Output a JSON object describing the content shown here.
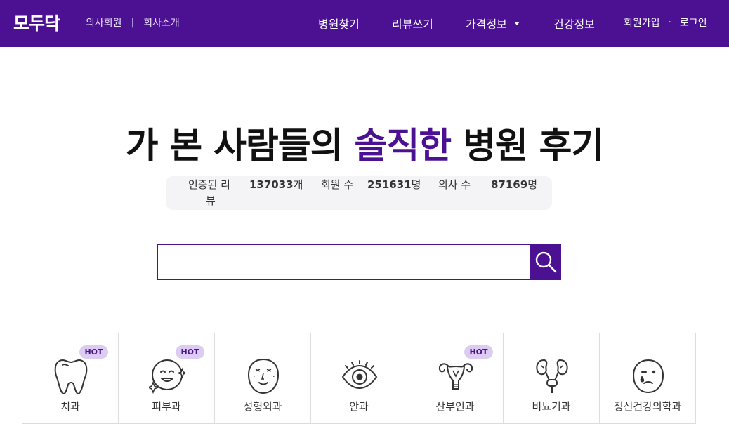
{
  "header": {
    "logo": "모두닥",
    "doctor_member": "의사회원",
    "divider": "|",
    "company_intro": "회사소개",
    "nav": {
      "find_hospital": "병원찾기",
      "write_review": "리뷰쓰기",
      "price_info": "가격정보",
      "health_info": "건강정보"
    },
    "signup": "회원가입",
    "dot": "·",
    "login": "로그인"
  },
  "hero": {
    "title_before": "가 본 사람들의",
    "title_accent": "솔직한",
    "title_after": "병원 후기"
  },
  "stats": {
    "reviews_label_line1": "인증된 리",
    "reviews_label_line2": "뷰",
    "reviews_value": "137033",
    "reviews_unit": "개",
    "members_label": "회원 수",
    "members_value": "251631",
    "members_unit": "명",
    "doctors_label": "의사 수",
    "doctors_value": "87169",
    "doctors_unit": "명"
  },
  "search": {
    "value": "",
    "placeholder": ""
  },
  "categories": [
    {
      "label": "치과",
      "icon": "tooth-icon",
      "hot": "HOT"
    },
    {
      "label": "피부과",
      "icon": "face-sparkle-icon",
      "hot": "HOT"
    },
    {
      "label": "성형외과",
      "icon": "face-outline-icon",
      "hot": ""
    },
    {
      "label": "안과",
      "icon": "eye-icon",
      "hot": ""
    },
    {
      "label": "산부인과",
      "icon": "uterus-icon",
      "hot": "HOT"
    },
    {
      "label": "비뇨기과",
      "icon": "kidney-icon",
      "hot": ""
    },
    {
      "label": "정신건강의학과",
      "icon": "sad-face-icon",
      "hot": ""
    }
  ],
  "colors": {
    "brand": "#4b1192",
    "hot_badge_bg": "#dcccf2"
  }
}
